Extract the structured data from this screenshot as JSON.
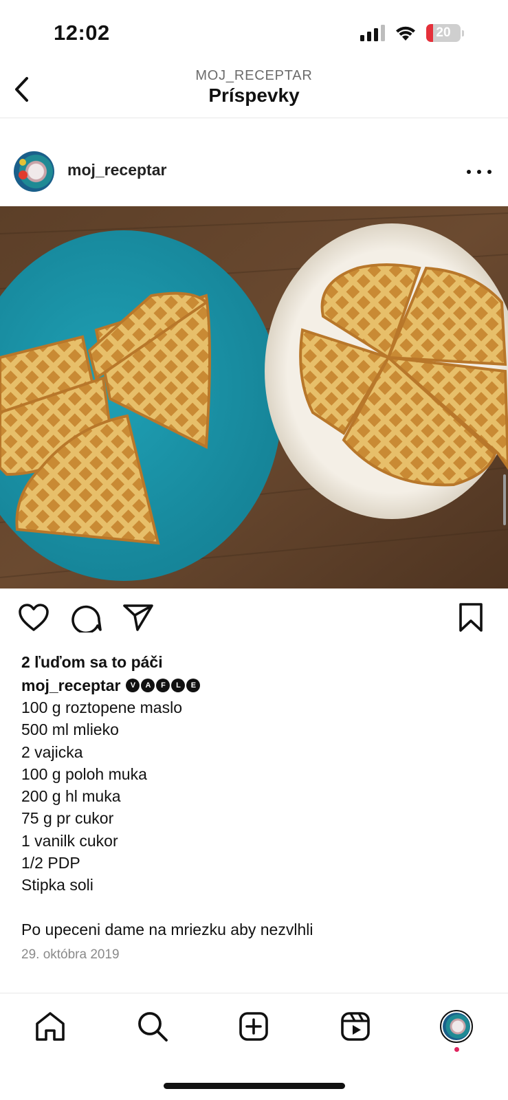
{
  "status_bar": {
    "time": "12:02",
    "battery": "20",
    "battery_level": 0.2
  },
  "header": {
    "subtitle": "MOJ_RECEPTAR",
    "title": "Príspevky"
  },
  "post": {
    "username": "moj_receptar",
    "likes": "2 ľuďom sa to páči",
    "caption_user": "moj_receptar",
    "badges": [
      "V",
      "A",
      "F",
      "L",
      "E"
    ],
    "lines": [
      "100 g roztopene maslo",
      "500 ml mlieko",
      "2 vajicka",
      "100 g poloh muka",
      "200 g hl muka",
      "75 g pr cukor",
      "1 vanilk cukor",
      "1/2 PDP",
      "Stipka soli"
    ],
    "closing_line": "Po upeceni dame na mriezku aby nezvlhli",
    "date": "29. októbra 2019"
  },
  "icons": {
    "back": "chevron-left-icon",
    "more": "ellipsis-icon",
    "like": "heart-icon",
    "comment": "comment-icon",
    "share": "paper-plane-icon",
    "save": "bookmark-icon",
    "nav": [
      "home-icon",
      "search-icon",
      "add-post-icon",
      "reels-icon",
      "profile-avatar"
    ]
  },
  "colors": {
    "accent_dot": "#e0245e",
    "battery_low": "#e5303a"
  }
}
